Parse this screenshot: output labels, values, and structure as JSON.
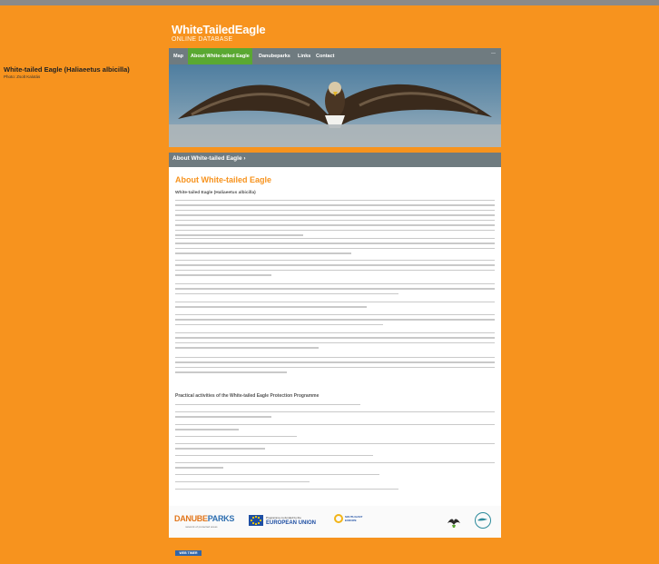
{
  "site": {
    "title": "WhiteTailedEagle",
    "subtitle": "ONLINE DATABASE"
  },
  "nav": {
    "items": [
      {
        "label": "Map",
        "active": false
      },
      {
        "label": "About White-tailed Eagle",
        "active": true
      },
      {
        "label": "Danubeparks",
        "active": false
      },
      {
        "label": "Links",
        "active": false
      },
      {
        "label": "Contact",
        "active": false
      }
    ]
  },
  "hero": {
    "title": "White-tailed Eagle (Haliaeetus albicilla)",
    "credit": "Photo: Zsolt Kalotás"
  },
  "section": {
    "title": "About White-tailed Eagle ›"
  },
  "article": {
    "heading": "About White-tailed Eagle",
    "scientific_name": "White-tailed Eagle (Haliaeetus albicilla)",
    "subheading": "Practical activities of the White-tailed Eagle Protection Programme"
  },
  "footer": {
    "danube_logo_main": "DANUBE",
    "danube_logo_tail": "PARKS",
    "danube_logo_sub": "network of protected areas",
    "eu_text_small": "Programme co-funded by the",
    "eu_text_main": "EUROPEAN UNION",
    "see_text": "SOUTH EAST EUROPE",
    "badge": "WEB TIMER"
  },
  "colors": {
    "background": "#f7931e",
    "accent": "#f7931e",
    "nav_active": "#5aa832",
    "nav_bg": "#6f7b80"
  }
}
